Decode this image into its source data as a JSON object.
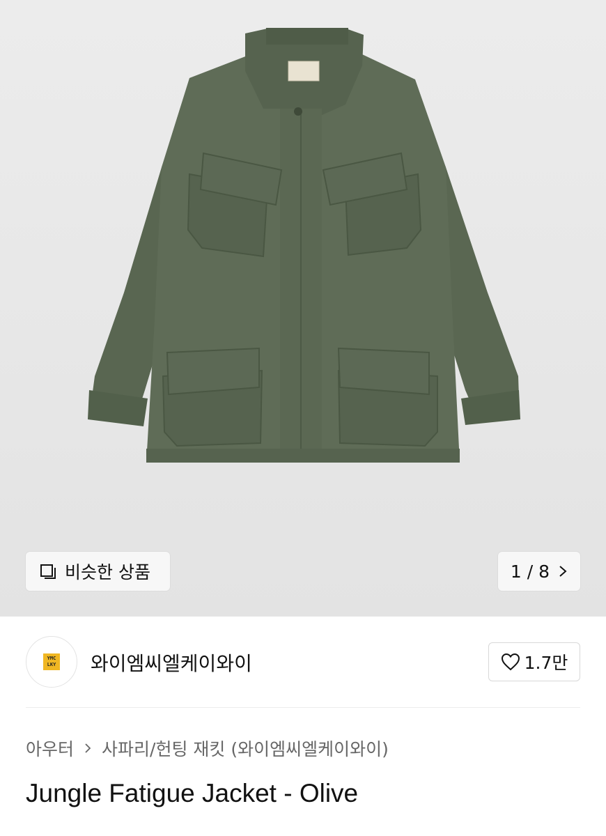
{
  "hero": {
    "image": "olive-jungle-fatigue-jacket-photo",
    "similar_label": "비슷한 상품",
    "similar_icon": "similar-items-icon",
    "pager_text": "1 / 8",
    "pager_icon": "chevron-right-icon"
  },
  "brand": {
    "logo_text": "YMC LKY",
    "logo_color": "#f0b723",
    "name": "와이엠씨엘케이와이",
    "like_icon": "heart-outline-icon",
    "like_count": "1.7만"
  },
  "breadcrumb": {
    "category": "아우터",
    "subcategory": "사파리/헌팅 재킷 (와이엠씨엘케이와이)"
  },
  "product": {
    "title": "Jungle Fatigue Jacket - Olive"
  },
  "colors": {
    "jacket": "#5d6a55",
    "background": "#e8e8e8"
  }
}
